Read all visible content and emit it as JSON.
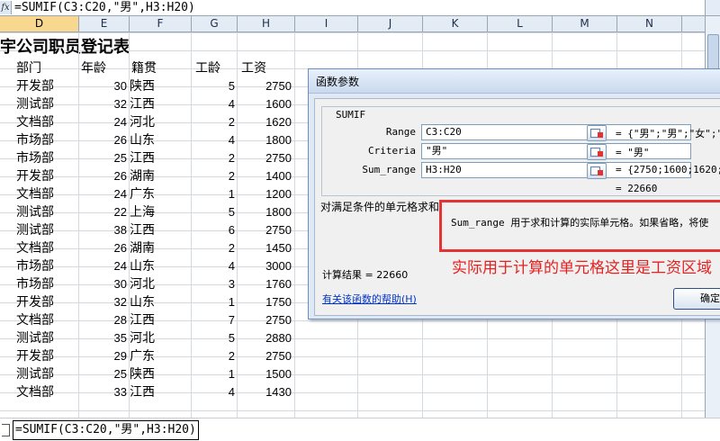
{
  "formula_bar": {
    "fx": "fx",
    "formula": "=SUMIF(C3:C20,\"男\",H3:H20)"
  },
  "columns": [
    "D",
    "E",
    "F",
    "G",
    "H",
    "I",
    "J",
    "K",
    "L",
    "M",
    "N"
  ],
  "sheet": {
    "title": "宇公司职员登记表",
    "headers": {
      "dept": "部门",
      "age": "年龄",
      "origin": "籍贯",
      "tenure": "工龄",
      "salary": "工资"
    },
    "rows": [
      {
        "dept": "开发部",
        "age": "30",
        "origin": "陕西",
        "tenure": "5",
        "salary": "2750"
      },
      {
        "dept": "测试部",
        "age": "32",
        "origin": "江西",
        "tenure": "4",
        "salary": "1600"
      },
      {
        "dept": "文档部",
        "age": "24",
        "origin": "河北",
        "tenure": "2",
        "salary": "1620"
      },
      {
        "dept": "市场部",
        "age": "26",
        "origin": "山东",
        "tenure": "4",
        "salary": "1800"
      },
      {
        "dept": "市场部",
        "age": "25",
        "origin": "江西",
        "tenure": "2",
        "salary": "2750"
      },
      {
        "dept": "开发部",
        "age": "26",
        "origin": "湖南",
        "tenure": "2",
        "salary": "1400"
      },
      {
        "dept": "文档部",
        "age": "24",
        "origin": "广东",
        "tenure": "1",
        "salary": "1200"
      },
      {
        "dept": "测试部",
        "age": "22",
        "origin": "上海",
        "tenure": "5",
        "salary": "1800"
      },
      {
        "dept": "测试部",
        "age": "38",
        "origin": "江西",
        "tenure": "6",
        "salary": "2750"
      },
      {
        "dept": "文档部",
        "age": "26",
        "origin": "湖南",
        "tenure": "2",
        "salary": "1450"
      },
      {
        "dept": "市场部",
        "age": "24",
        "origin": "山东",
        "tenure": "4",
        "salary": "3000"
      },
      {
        "dept": "市场部",
        "age": "30",
        "origin": "河北",
        "tenure": "3",
        "salary": "1760"
      },
      {
        "dept": "开发部",
        "age": "32",
        "origin": "山东",
        "tenure": "1",
        "salary": "1750"
      },
      {
        "dept": "文档部",
        "age": "28",
        "origin": "江西",
        "tenure": "7",
        "salary": "2750"
      },
      {
        "dept": "测试部",
        "age": "35",
        "origin": "河北",
        "tenure": "5",
        "salary": "2880"
      },
      {
        "dept": "开发部",
        "age": "29",
        "origin": "广东",
        "tenure": "2",
        "salary": "2750"
      },
      {
        "dept": "测试部",
        "age": "25",
        "origin": "陕西",
        "tenure": "1",
        "salary": "1500"
      },
      {
        "dept": "文档部",
        "age": "33",
        "origin": "江西",
        "tenure": "4",
        "salary": "1430"
      }
    ]
  },
  "dialog": {
    "title": "函数参数",
    "function_name": "SUMIF",
    "args": [
      {
        "label": "Range",
        "value": "C3:C20",
        "result": "= {\"男\";\"男\";\"女\";\"男\""
      },
      {
        "label": "Criteria",
        "value": "\"男\"",
        "result": "= \"男\""
      },
      {
        "label": "Sum_range",
        "value": "H3:H20",
        "result": "= {2750;1600;1620;18"
      }
    ],
    "total_preview": "= 22660",
    "description": "对满足条件的单元格求和",
    "arg_help": "Sum_range  用于求和计算的实际单元格。如果省略，将使",
    "result_label": "计算结果 =",
    "result_value": "22660",
    "help_link": "有关该函数的帮助(H)",
    "ok_label": "确定"
  },
  "annotation": "实际用于计算的单元格这里是工资区域",
  "bottom_formula": "=SUMIF(C3:C20,\"男\",H3:H20)",
  "colors": {
    "annotation": "#e52222",
    "highlight_box": "#e53333",
    "dialog_bg": "#dfe9f6",
    "header_bg": "#e3ebf5"
  }
}
